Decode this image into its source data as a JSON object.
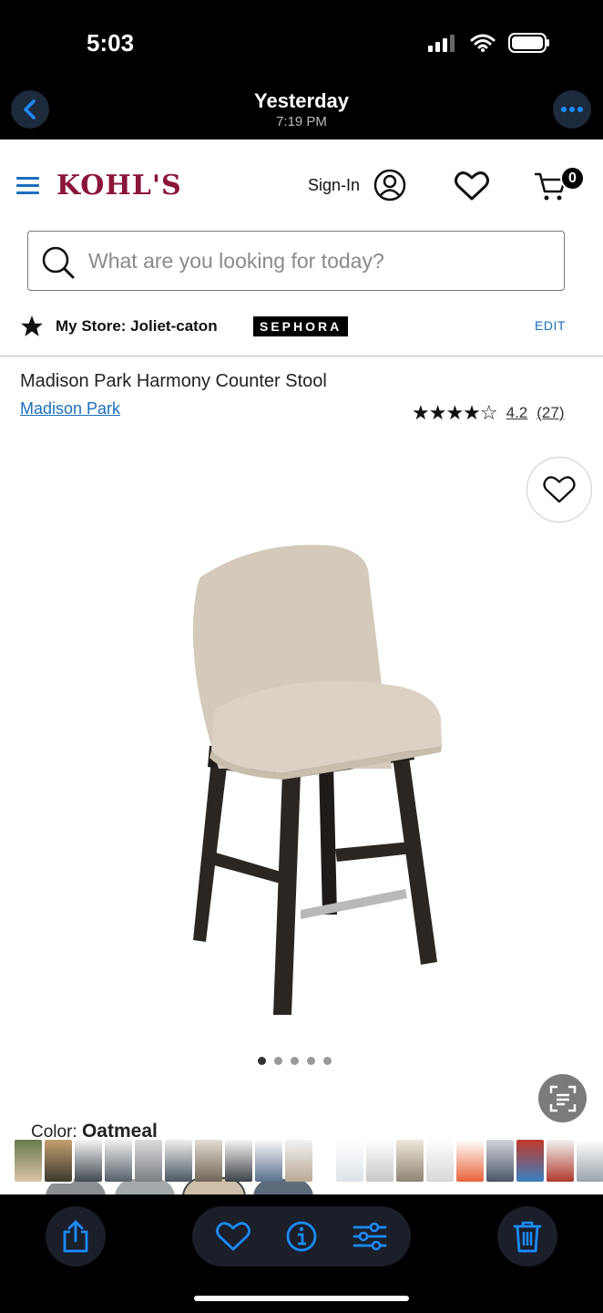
{
  "status_bar": {
    "time": "5:03"
  },
  "photo_nav": {
    "title": "Yesterday",
    "subtitle": "7:19 PM"
  },
  "header": {
    "logo": "KOHL'S",
    "signin_label": "Sign-In",
    "cart_count": "0"
  },
  "search": {
    "placeholder": "What are you looking for today?"
  },
  "store": {
    "label": "My Store: Joliet-caton",
    "sephora_label": "SEPHORA",
    "edit_label": "EDIT"
  },
  "product": {
    "title": "Madison Park Harmony Counter Stool",
    "brand": "Madison Park",
    "rating_stars": "★★★★☆",
    "rating": "4.2",
    "review_count": "(27)",
    "color_prefix": "Color:",
    "color_value": "Oatmeal"
  },
  "carousel": {
    "total": 5,
    "active": 0
  },
  "colors": {
    "brand": "#8a1538",
    "link": "#1a6fbd",
    "ios_accent": "#1a8cff",
    "seat_fabric": "#d8ccbf",
    "legs": "#2b2622"
  },
  "icons": {
    "back": "chevron-left-icon",
    "more": "ellipsis-icon",
    "menu": "hamburger-menu-icon",
    "account": "user-icon",
    "wishlist": "heart-icon",
    "cart": "cart-icon",
    "search": "search-icon",
    "store": "star-icon",
    "live_text": "live-text-icon",
    "share": "share-icon",
    "favorite": "heart-icon",
    "info": "info-icon",
    "adjust": "sliders-icon",
    "delete": "trash-icon"
  }
}
